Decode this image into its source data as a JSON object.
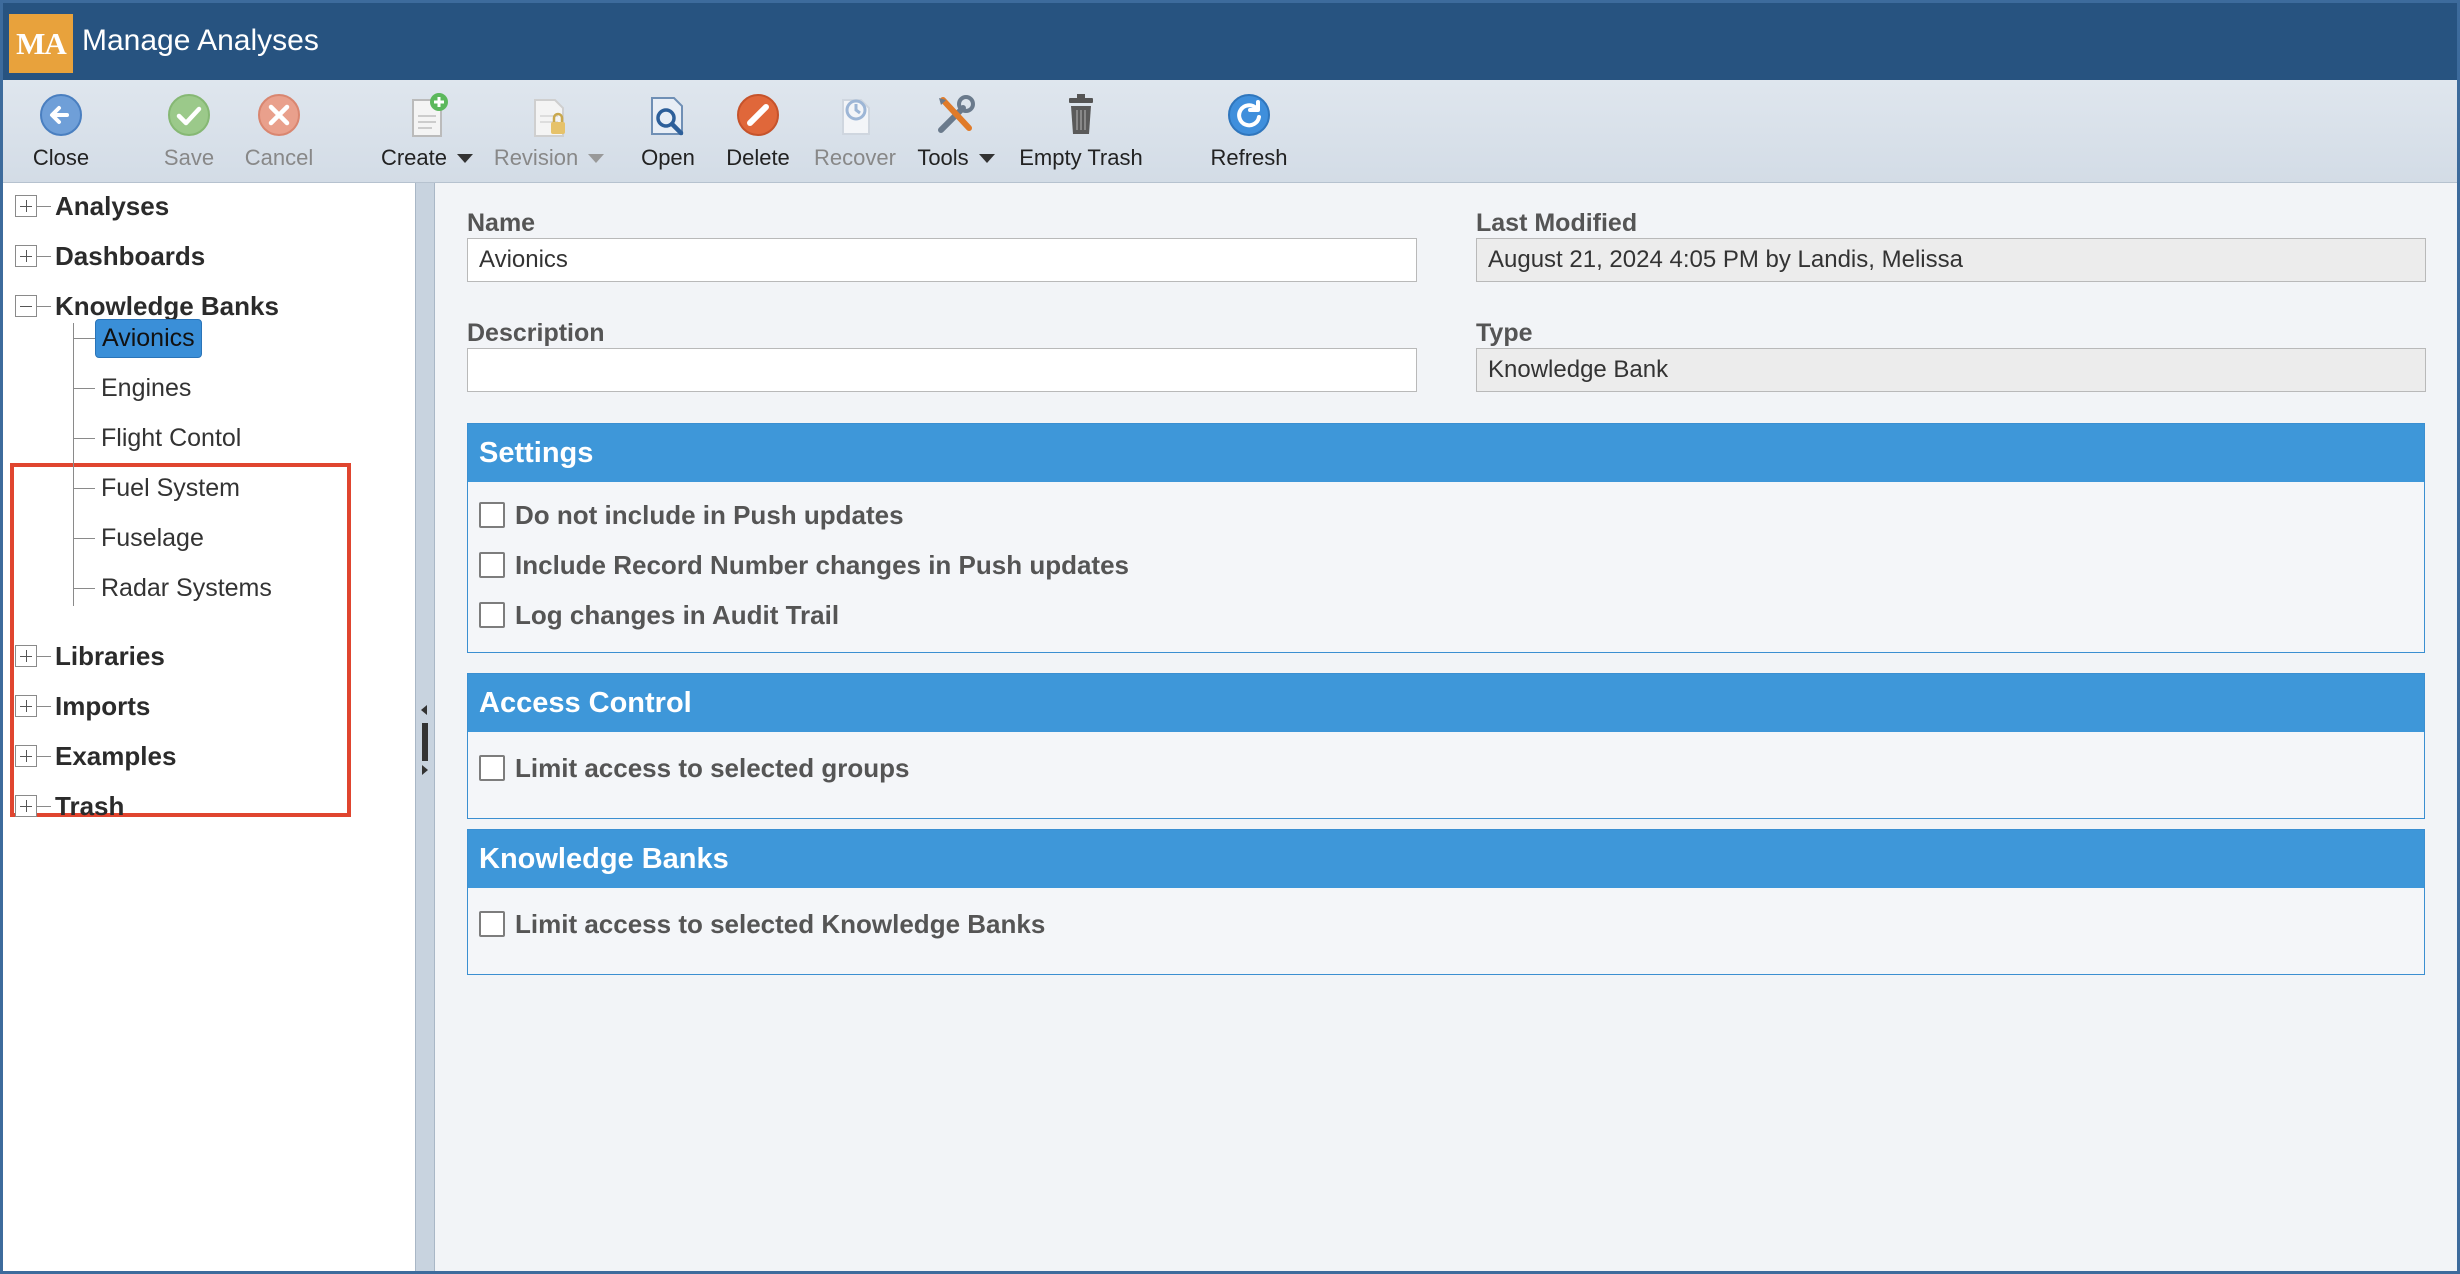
{
  "window": {
    "logo_text": "MA",
    "title": "Manage Analyses"
  },
  "toolbar": {
    "buttons": [
      {
        "label": "Close",
        "icon": "back-arrow-icon",
        "enabled": true
      },
      {
        "label": "Save",
        "icon": "checkmark-icon",
        "enabled": false
      },
      {
        "label": "Cancel",
        "icon": "cancel-x-icon",
        "enabled": false
      },
      {
        "label": "Create",
        "icon": "new-document-icon",
        "enabled": true,
        "dropdown": true
      },
      {
        "label": "Revision",
        "icon": "locked-document-icon",
        "enabled": false,
        "dropdown": true
      },
      {
        "label": "Open",
        "icon": "open-document-icon",
        "enabled": true
      },
      {
        "label": "Delete",
        "icon": "delete-icon",
        "enabled": true
      },
      {
        "label": "Recover",
        "icon": "recover-icon",
        "enabled": false
      },
      {
        "label": "Tools",
        "icon": "tools-icon",
        "enabled": true,
        "dropdown": true
      },
      {
        "label": "Empty Trash",
        "icon": "trash-icon",
        "enabled": true
      },
      {
        "label": "Refresh",
        "icon": "refresh-icon",
        "enabled": true
      }
    ]
  },
  "tree": {
    "nodes": [
      {
        "label": "Analyses",
        "expanded": false
      },
      {
        "label": "Dashboards",
        "expanded": false
      },
      {
        "label": "Knowledge Banks",
        "expanded": true,
        "children": [
          "Avionics",
          "Engines",
          "Flight Contol",
          "Fuel System",
          "Fuselage",
          "Radar Systems"
        ],
        "selected_child": "Avionics"
      },
      {
        "label": "Libraries",
        "expanded": false
      },
      {
        "label": "Imports",
        "expanded": false
      },
      {
        "label": "Examples",
        "expanded": false
      },
      {
        "label": "Trash",
        "expanded": false
      }
    ]
  },
  "form": {
    "name_label": "Name",
    "name_value": "Avionics",
    "last_modified_label": "Last Modified",
    "last_modified_value": "August 21, 2024 4:05 PM by Landis, Melissa",
    "description_label": "Description",
    "description_value": "",
    "type_label": "Type",
    "type_value": "Knowledge Bank"
  },
  "panels": {
    "settings": {
      "title": "Settings",
      "options": [
        {
          "label": "Do not include in Push updates",
          "checked": false
        },
        {
          "label": "Include Record Number changes in Push updates",
          "checked": false
        },
        {
          "label": "Log changes in Audit Trail",
          "checked": false
        }
      ]
    },
    "access_control": {
      "title": "Access Control",
      "options": [
        {
          "label": "Limit access to selected groups",
          "checked": false
        }
      ]
    },
    "knowledge_banks": {
      "title": "Knowledge Banks",
      "options": [
        {
          "label": "Limit access to selected Knowledge Banks",
          "checked": false
        }
      ]
    }
  },
  "colors": {
    "titlebar": "#275380",
    "logo": "#e8a23c",
    "panel_header": "#3e97d9",
    "selection": "#3a8fd8",
    "highlight_box": "#e0452f"
  }
}
